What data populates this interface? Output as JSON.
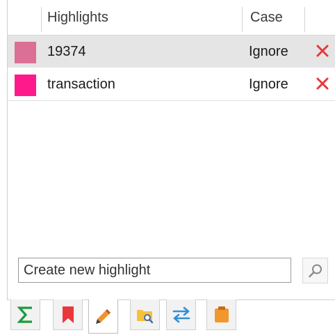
{
  "table": {
    "columns": {
      "highlights": "Highlights",
      "case": "Case"
    },
    "rows": [
      {
        "term": "19374",
        "case": "Ignore",
        "color": "#db6f95",
        "selected": true
      },
      {
        "term": "transaction",
        "case": "Ignore",
        "color": "#ff1a8c",
        "selected": false
      }
    ]
  },
  "new_highlight": {
    "placeholder": "Create new highlight",
    "value": ""
  },
  "colors": {
    "delete": "#e8383d",
    "panel_border": "#d0d0d0",
    "selection": "#e5e5e5"
  },
  "tabs": [
    {
      "icon": "sigma-icon",
      "active": false
    },
    {
      "icon": "bookmark-icon",
      "active": false
    },
    {
      "icon": "pencil-icon",
      "active": true
    },
    {
      "icon": "folder-search-icon",
      "active": false
    },
    {
      "icon": "swap-arrows-icon",
      "active": false
    },
    {
      "icon": "sticky-note-icon",
      "active": false
    }
  ]
}
